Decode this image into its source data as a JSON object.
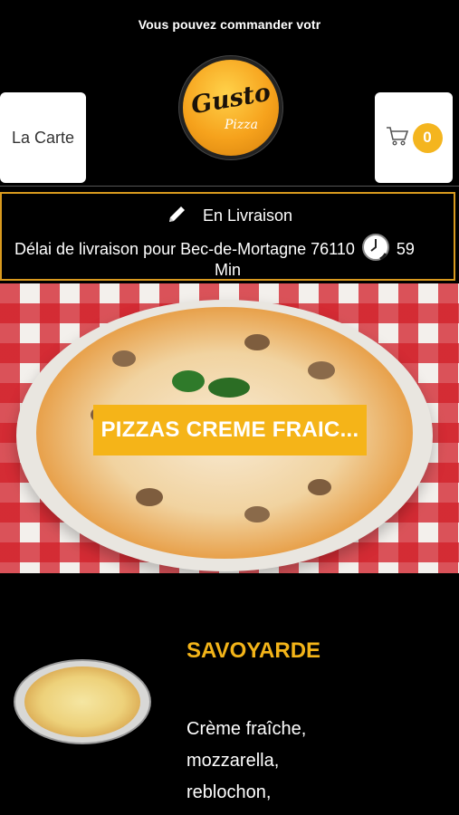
{
  "ticker": {
    "text": "Vous pouvez commander votr"
  },
  "header": {
    "menu_label": "La Carte",
    "cart_count": "0",
    "logo_text": "Gusto",
    "logo_sub": "Pizza"
  },
  "delivery": {
    "mode": "En Livraison",
    "delay_text": "Délai de livraison pour Bec-de-Mortagne 76110",
    "minutes": "59",
    "unit": "Min"
  },
  "hero": {
    "category": "PIZZAS CREME FRAIC..."
  },
  "product": {
    "name": "SAVOYARDE",
    "description": "Crème fraîche, mozzarella, reblochon,"
  },
  "colors": {
    "accent": "#f5b418",
    "border": "#d99a1e",
    "background": "#000000"
  },
  "icons": [
    "pencil-icon",
    "cart-icon",
    "clock-icon"
  ]
}
